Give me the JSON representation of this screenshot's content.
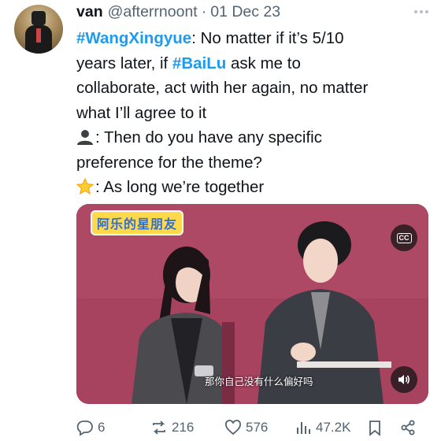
{
  "author": {
    "name": "van",
    "handle": "@afterrnoont",
    "separator": "·",
    "date": "01 Dec 23"
  },
  "tweet": {
    "line1_hashtag": "#WangXingyue",
    "line1_rest": ": No matter if it’s 5/10",
    "line2_pre": "years later, if ",
    "line2_hashtag": "#BaiLu",
    "line2_rest": " ask me to",
    "line3": "collaborate, act with her again, no matter",
    "line4": "what I’ll agree to it",
    "line5_rest": ": Then do you have any specific",
    "line6": "preference for the theme?",
    "line7_rest": ": As long we’re together"
  },
  "icons": {
    "line5_emoji": "bust-in-silhouette-icon",
    "line7_emoji": "star-icon"
  },
  "media": {
    "logo_text": "阿乐的星朋友",
    "cc_label": "CC",
    "caption": "那你自己没有什么偏好吗"
  },
  "actions": {
    "replies": "6",
    "reposts": "216",
    "likes": "576",
    "views": "47.2K"
  },
  "colors": {
    "hashtag": "#1d9bf0",
    "muted": "#536471",
    "text": "#0f1419",
    "media_bg": "#a5405f"
  }
}
